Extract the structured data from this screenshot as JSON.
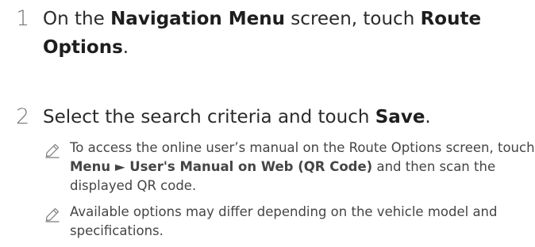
{
  "steps": [
    {
      "number": "1",
      "prefix": "On the ",
      "bold1": "Navigation Menu",
      "middle": " screen, touch ",
      "bold2": "Route Options",
      "suffix": "."
    },
    {
      "number": "2",
      "prefix": "Select the search criteria and touch ",
      "bold1": "Save",
      "suffix": "."
    }
  ],
  "notes": [
    {
      "icon": "pencil-icon",
      "prefix": "To access the online user’s manual on the Route Options screen, touch ",
      "bold": "Menu ► User's Manual on Web (QR Code)",
      "suffix": " and then scan the displayed QR code."
    },
    {
      "icon": "pencil-icon",
      "text": "Available options may differ depending on the vehicle model and specifications."
    }
  ]
}
